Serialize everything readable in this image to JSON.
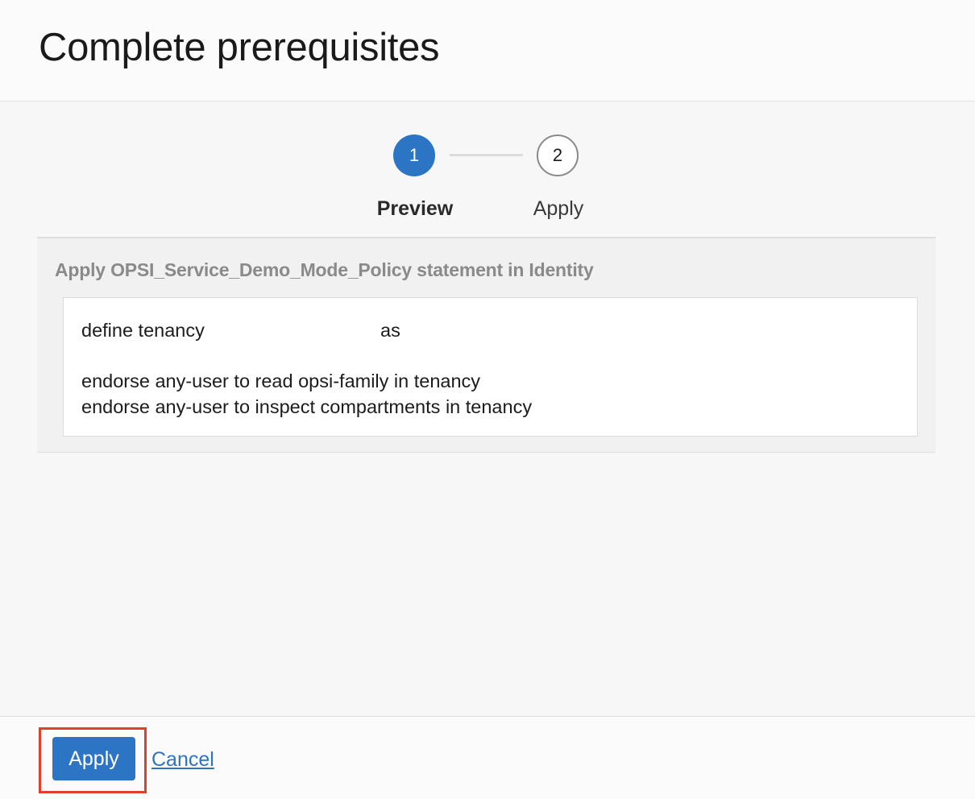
{
  "dialog": {
    "title": "Complete prerequisites"
  },
  "stepper": {
    "steps": [
      {
        "number": "1",
        "label": "Preview",
        "state": "current"
      },
      {
        "number": "2",
        "label": "Apply",
        "state": "pending"
      }
    ]
  },
  "policy": {
    "heading": "Apply OPSI_Service_Demo_Mode_Policy statement in Identity",
    "lines": [
      {
        "prefix": "define tenancy",
        "suffix": "as"
      },
      {
        "text": "endorse any-user to read opsi-family in tenancy"
      },
      {
        "text": "endorse any-user to inspect compartments in tenancy"
      }
    ]
  },
  "footer": {
    "apply_label": "Apply",
    "cancel_label": "Cancel"
  },
  "colors": {
    "accent": "#2c74c4",
    "highlight": "#e0402b"
  }
}
